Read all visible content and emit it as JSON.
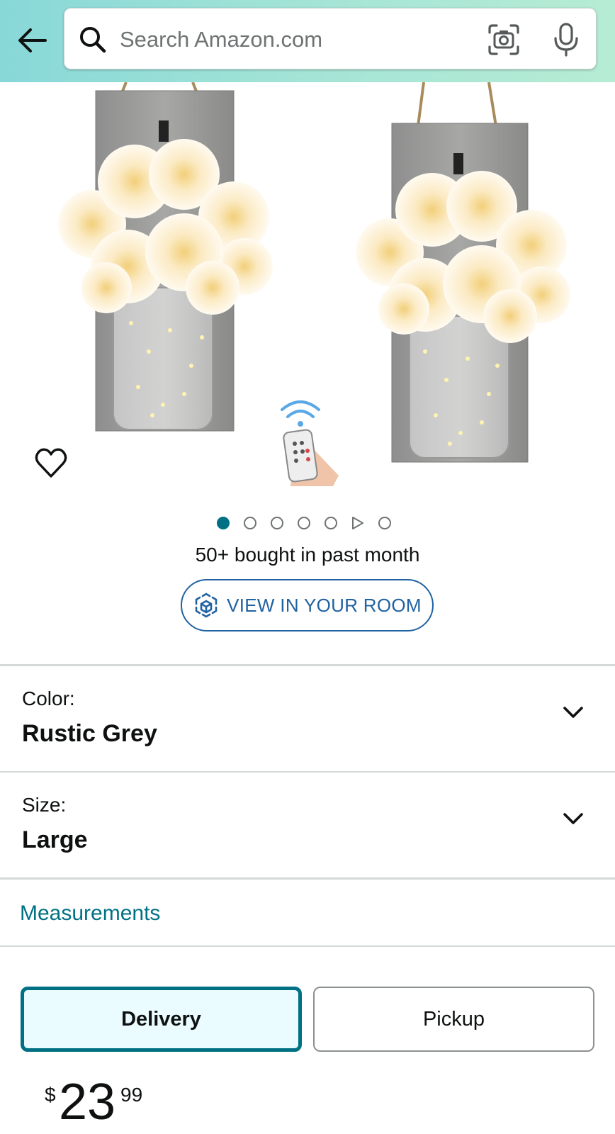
{
  "search": {
    "placeholder": "Search Amazon.com"
  },
  "gallery": {
    "image_count": 7,
    "active_index": 0,
    "video_index": 5
  },
  "social_proof": {
    "bought_text": "50+ bought in past month"
  },
  "view_in_room": {
    "label": "VIEW IN YOUR ROOM"
  },
  "options": {
    "color": {
      "label": "Color:",
      "value": "Rustic Grey"
    },
    "size": {
      "label": "Size:",
      "value": "Large"
    }
  },
  "measurements": {
    "label": "Measurements"
  },
  "fulfillment": {
    "delivery_label": "Delivery",
    "pickup_label": "Pickup",
    "selected": "Delivery"
  },
  "price": {
    "symbol": "$",
    "whole": "23",
    "fraction": "99"
  },
  "colors": {
    "header_start": "#88d8d8",
    "header_end": "#b6ecd4",
    "link": "#007185",
    "accent_blue": "#2162a1"
  }
}
